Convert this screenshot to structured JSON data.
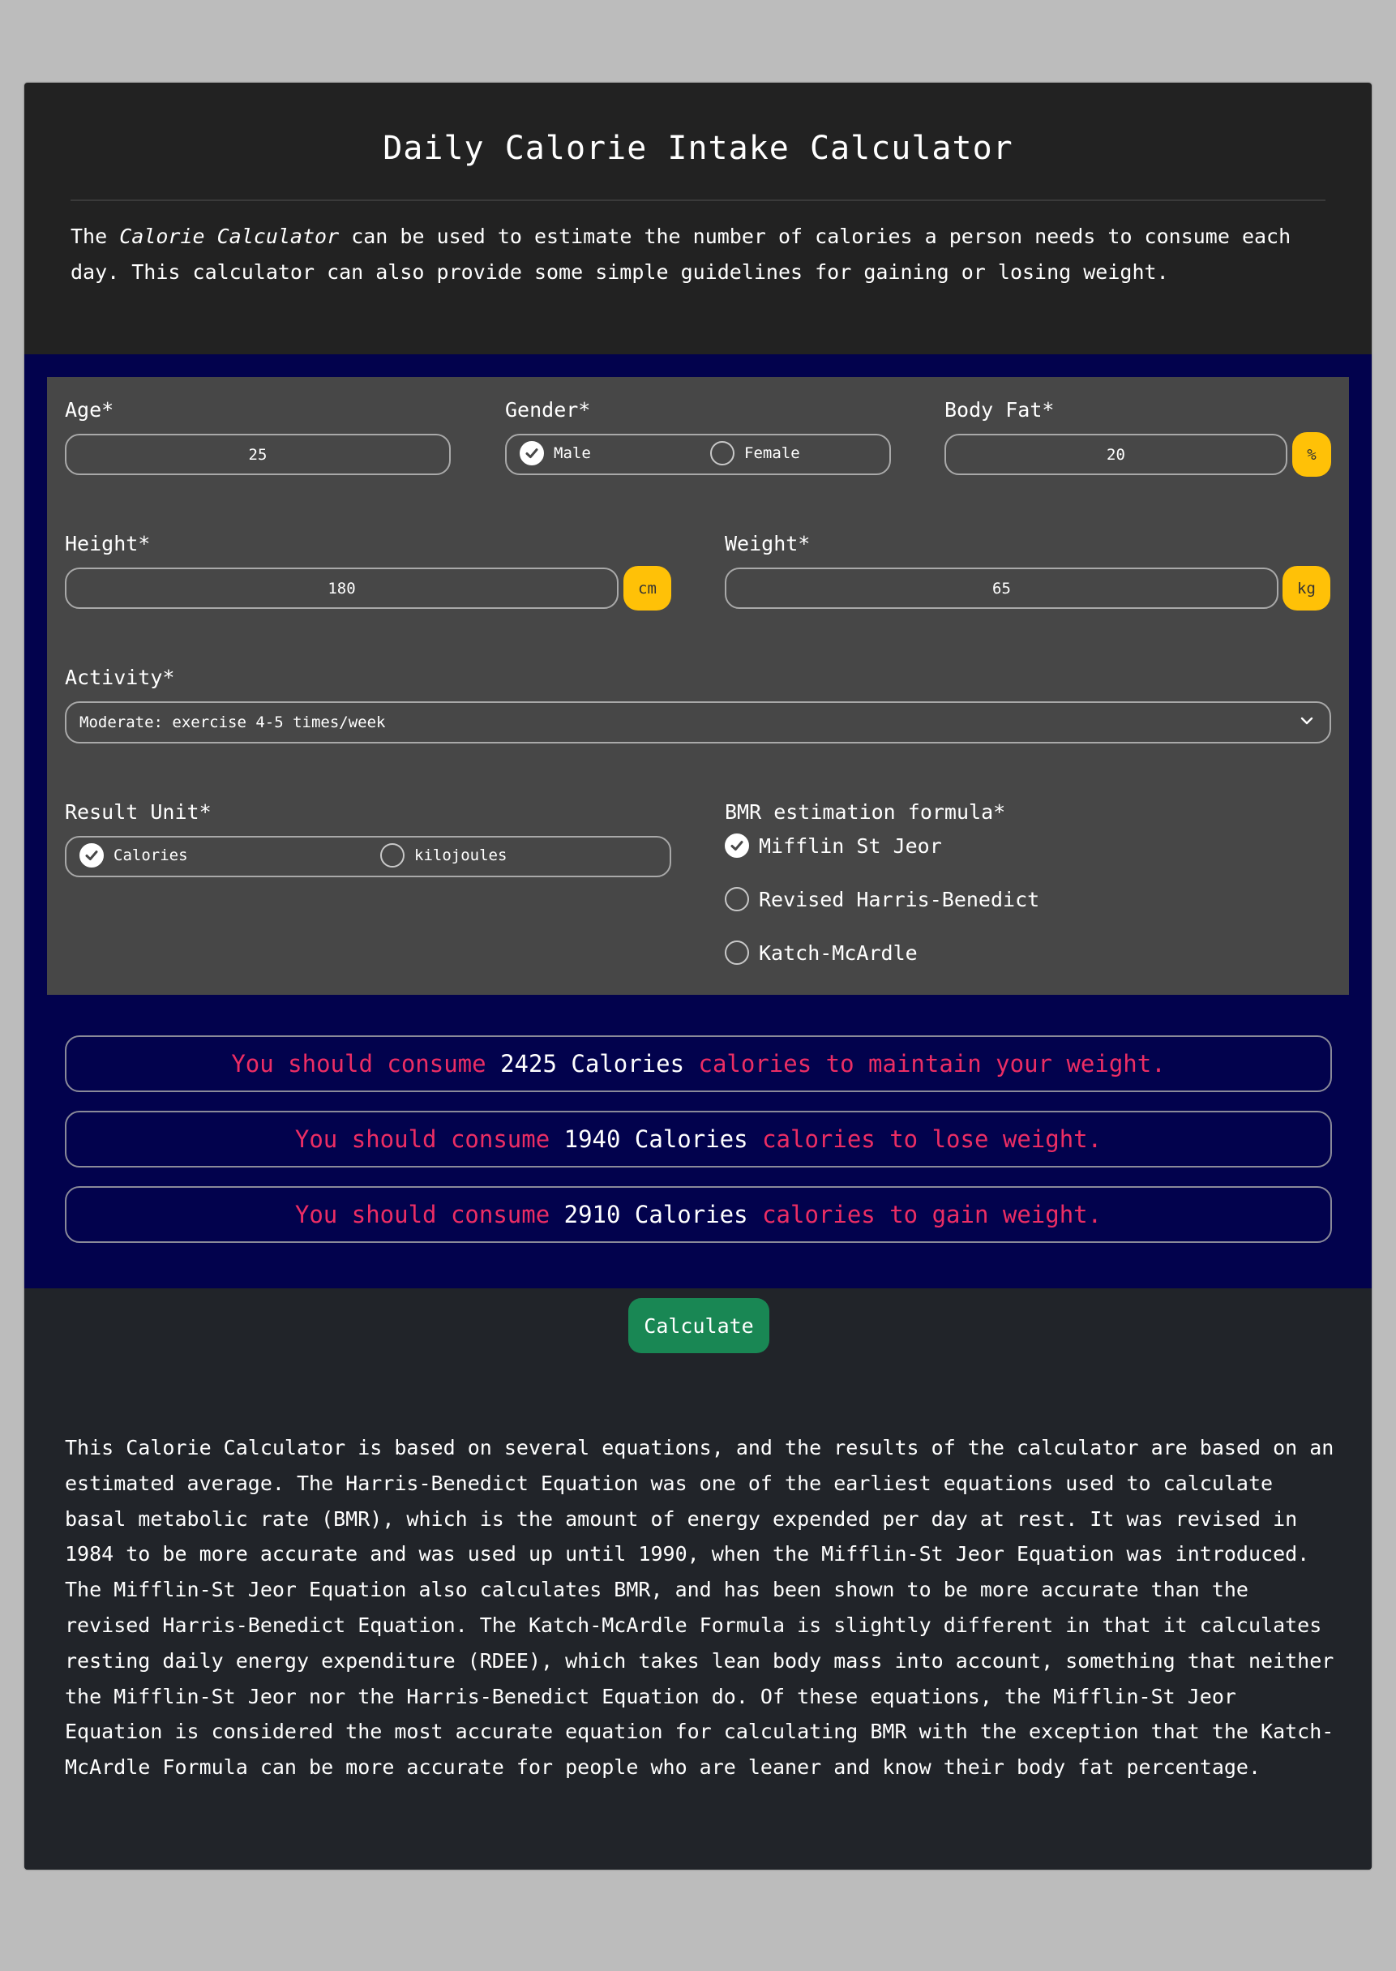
{
  "header": {
    "title": "Daily Calorie Intake Calculator",
    "intro_prefix": "The ",
    "intro_em": "Calorie Calculator",
    "intro_suffix": " can be used to estimate the number of calories a person needs to consume each day. This calculator can also provide some simple guidelines for gaining or losing weight."
  },
  "form": {
    "age": {
      "label": "Age*",
      "value": "25"
    },
    "gender": {
      "label": "Gender*",
      "options": [
        "Male",
        "Female"
      ],
      "selected": "Male"
    },
    "body_fat": {
      "label": "Body Fat*",
      "value": "20",
      "unit": "%"
    },
    "height": {
      "label": "Height*",
      "value": "180",
      "unit": "cm"
    },
    "weight": {
      "label": "Weight*",
      "value": "65",
      "unit": "kg"
    },
    "activity": {
      "label": "Activity*",
      "value": "Moderate: exercise 4-5 times/week"
    },
    "result_unit": {
      "label": "Result Unit*",
      "options": [
        "Calories",
        "kilojoules"
      ],
      "selected": "Calories"
    },
    "bmr": {
      "label": "BMR estimation formula*",
      "options": [
        "Mifflin St Jeor",
        "Revised Harris-Benedict",
        "Katch-McArdle"
      ],
      "selected": "Mifflin St Jeor"
    }
  },
  "results": [
    {
      "prefix": "You should consume ",
      "value": "2425 Calories",
      "suffix": " calories to maintain your weight."
    },
    {
      "prefix": "You should consume ",
      "value": "1940 Calories",
      "suffix": " calories to lose weight."
    },
    {
      "prefix": "You should consume ",
      "value": "2910 Calories",
      "suffix": " calories to gain weight."
    }
  ],
  "calculate_label": "Calculate",
  "about": "This Calorie Calculator is based on several equations, and the results of the calculator are based on an estimated average. The Harris-Benedict Equation was one of the earliest equations used to calculate basal metabolic rate (BMR), which is the amount of energy expended per day at rest. It was revised in 1984 to be more accurate and was used up until 1990, when the Mifflin-St Jeor Equation was introduced. The Mifflin-St Jeor Equation also calculates BMR, and has been shown to be more accurate than the revised Harris-Benedict Equation. The Katch-McArdle Formula is slightly different in that it calculates resting daily energy expenditure (RDEE), which takes lean body mass into account, something that neither the Mifflin-St Jeor nor the Harris-Benedict Equation do. Of these equations, the Mifflin-St Jeor Equation is considered the most accurate equation for calculating BMR with the exception that the Katch-McArdle Formula can be more accurate for people who are leaner and know their body fat percentage.",
  "colors": {
    "accent_unit": "#ffc107",
    "calculate_button": "#198754",
    "result_highlight": "#ec2d64",
    "band": "#02024d"
  }
}
